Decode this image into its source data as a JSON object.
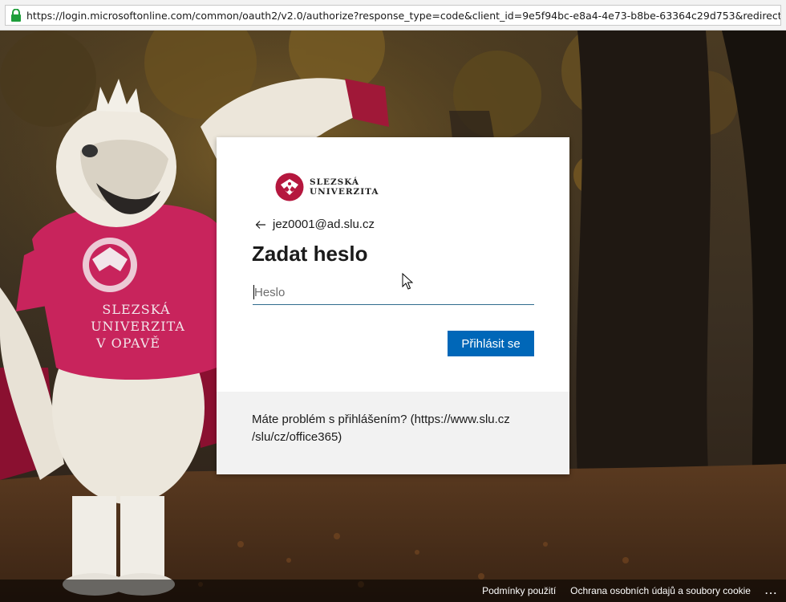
{
  "browser": {
    "url": "https://login.microsoftonline.com/common/oauth2/v2.0/authorize?response_type=code&client_id=9e5f94bc-e8a4-4e73-b8be-63364c29d753&redirect_uri=https%3A%2F%2Floca"
  },
  "mascot": {
    "shirt_line1": "SLEZSKÁ",
    "shirt_line2": "UNIVERZITA",
    "shirt_line3": "V OPAVĚ"
  },
  "card": {
    "logo_line1": "SLEZSKÁ",
    "logo_line2": "UNIVERZITA",
    "account": "jez0001@ad.slu.cz",
    "title": "Zadat heslo",
    "password_placeholder": "Heslo",
    "password_value": "",
    "signin_label": "Přihlásit se",
    "help_text": "Máte problém s přihlášením? (https://www.slu.cz /slu/cz/office365)",
    "accent_color": "#0067b8"
  },
  "footer": {
    "terms": "Podmínky použití",
    "privacy": "Ochrana osobních údajů a soubory cookie",
    "more": "..."
  }
}
